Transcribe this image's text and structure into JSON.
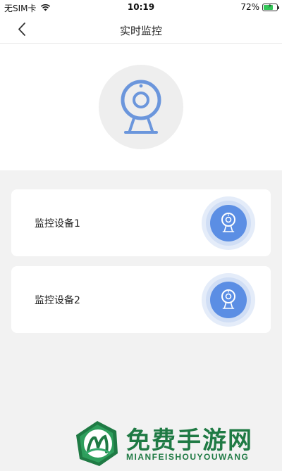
{
  "status_bar": {
    "carrier": "无SIM卡",
    "time": "10:19",
    "battery": "72%",
    "battery_level": 0.72
  },
  "nav": {
    "title": "实时监控",
    "back_icon": "chevron-left-icon"
  },
  "hero": {
    "icon": "webcam-icon"
  },
  "devices": [
    {
      "label": "监控设备1",
      "icon": "webcam-icon"
    },
    {
      "label": "监控设备2",
      "icon": "webcam-icon"
    }
  ],
  "watermark": {
    "title": "免费手游网",
    "subtitle": "MIANFEISHOUYOUWANG"
  },
  "colors": {
    "accent": "#5b8ee4",
    "hero_icon": "#6b96dc",
    "watermark": "#1f7a44"
  }
}
